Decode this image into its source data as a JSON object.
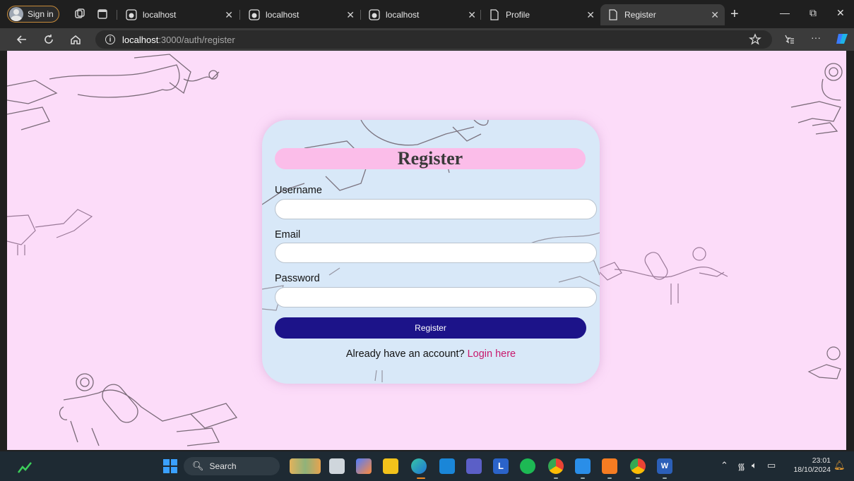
{
  "browser": {
    "signin_label": "Sign in",
    "tabs": [
      {
        "title": "localhost",
        "favicon": "localhost-favicon"
      },
      {
        "title": "localhost",
        "favicon": "localhost-favicon"
      },
      {
        "title": "localhost",
        "favicon": "localhost-favicon"
      },
      {
        "title": "Profile",
        "favicon": "page-icon"
      },
      {
        "title": "Register",
        "favicon": "page-icon",
        "active": true
      }
    ],
    "address": {
      "host": "localhost",
      "path": ":3000/auth/register"
    }
  },
  "page": {
    "title": "Register",
    "fields": [
      {
        "label": "Username",
        "value": ""
      },
      {
        "label": "Email",
        "value": ""
      },
      {
        "label": "Password",
        "value": ""
      }
    ],
    "submit_label": "Register",
    "login_prompt": "Already have an account?",
    "login_link": "Login here",
    "colors": {
      "background": "#fcdcf9",
      "card": "#d8e8f8",
      "title_pill": "#fbbde9",
      "button": "#1c1389",
      "link": "#c8196d"
    }
  },
  "taskbar": {
    "search_label": "Search",
    "time": "23:01",
    "date": "18/10/2024"
  }
}
